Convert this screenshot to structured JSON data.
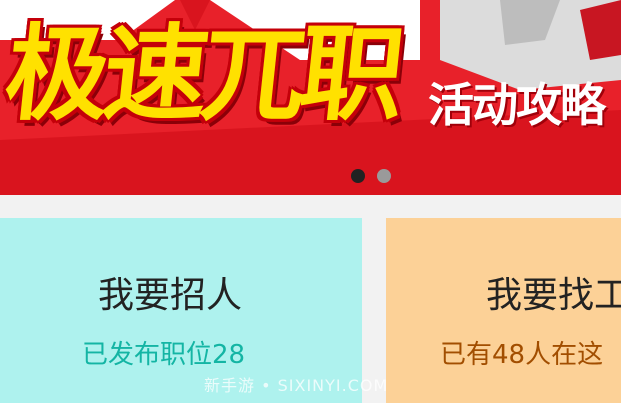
{
  "banner": {
    "title": "极速兀职",
    "subtitle": "活动攻略",
    "slide_count": 2,
    "active_slide": 1,
    "colors": {
      "background": "#e8212a",
      "title": "#ffe100",
      "subtitle": "#ffffff"
    }
  },
  "cards": {
    "recruit": {
      "title": "我要招人",
      "subtitle": "已发布职位28",
      "color": "#aef2ee"
    },
    "find_job": {
      "title": "我要找工",
      "subtitle": "已有48人在这",
      "color": "#fcd197"
    }
  },
  "watermark": "新手游 • SIXINYI.COM"
}
